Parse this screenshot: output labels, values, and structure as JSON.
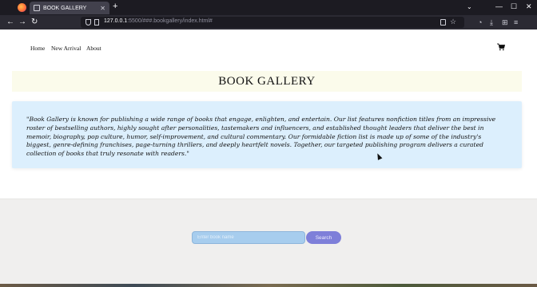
{
  "browser": {
    "tab_title": "BOOK GALLERY",
    "tab_close": "✕",
    "new_tab": "+",
    "tabs_menu": "⌄",
    "url_host": "127.0.0.1",
    "url_rest": ":5500/###.bookgallery/index.html#",
    "window_controls": {
      "minimize": "—",
      "maximize": "☐",
      "close": "✕"
    },
    "nav": {
      "back": "←",
      "forward": "→",
      "reload": "↻"
    },
    "icons": {
      "bookmark": "☆",
      "pocket": "◔",
      "downloads": "⤓",
      "extensions": "⊞",
      "menu": "≡"
    }
  },
  "site": {
    "nav_links": [
      "Home",
      "New Arrival",
      "About"
    ],
    "title": "BOOK GALLERY",
    "description": "\"Book Gallery is known for publishing a wide range of books that engage, enlighten, and entertain. Our list features nonfiction titles from an impressive roster of bestselling authors, highly sought after personalities, tastemakers and influencers, and established thought leaders that deliver the best in memoir, biography, pop culture, humor, self-improvement, and cultural commentary. Our formidable fiction list is made up of some of the industry's biggest, genre-defining franchises, page-turning thrillers, and deeply heartfelt novels. Together, our targeted publishing program delivers a curated collection of books that truly resonate with readers.\"",
    "search": {
      "placeholder": "Enter book name",
      "button_label": "Search"
    }
  },
  "colors": {
    "title_band": "#fbfbeb",
    "quote_box": "#dceffd",
    "search_input": "#a7cdee",
    "search_button": "#7e7fd9"
  }
}
